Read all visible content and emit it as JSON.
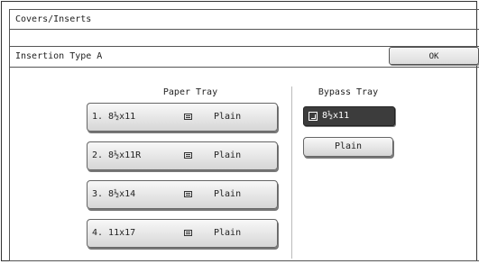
{
  "window": {
    "title": "Covers/Inserts"
  },
  "header": {
    "subtitle": "Insertion Type A",
    "ok_label": "OK"
  },
  "paper_tray": {
    "heading": "Paper Tray",
    "items": [
      {
        "label": "1. 8½x11",
        "type": "Plain"
      },
      {
        "label": "2. 8½x11R",
        "type": "Plain"
      },
      {
        "label": "3. 8½x14",
        "type": "Plain"
      },
      {
        "label": "4. 11x17",
        "type": "Plain"
      }
    ]
  },
  "bypass_tray": {
    "heading": "Bypass Tray",
    "size": "8½x11",
    "type": "Plain",
    "size_icon": "bypass-tray-icon"
  },
  "colors": {
    "selected_bg": "#3c3c3c",
    "button_bg": "#e6e6e6",
    "border": "#555555"
  }
}
